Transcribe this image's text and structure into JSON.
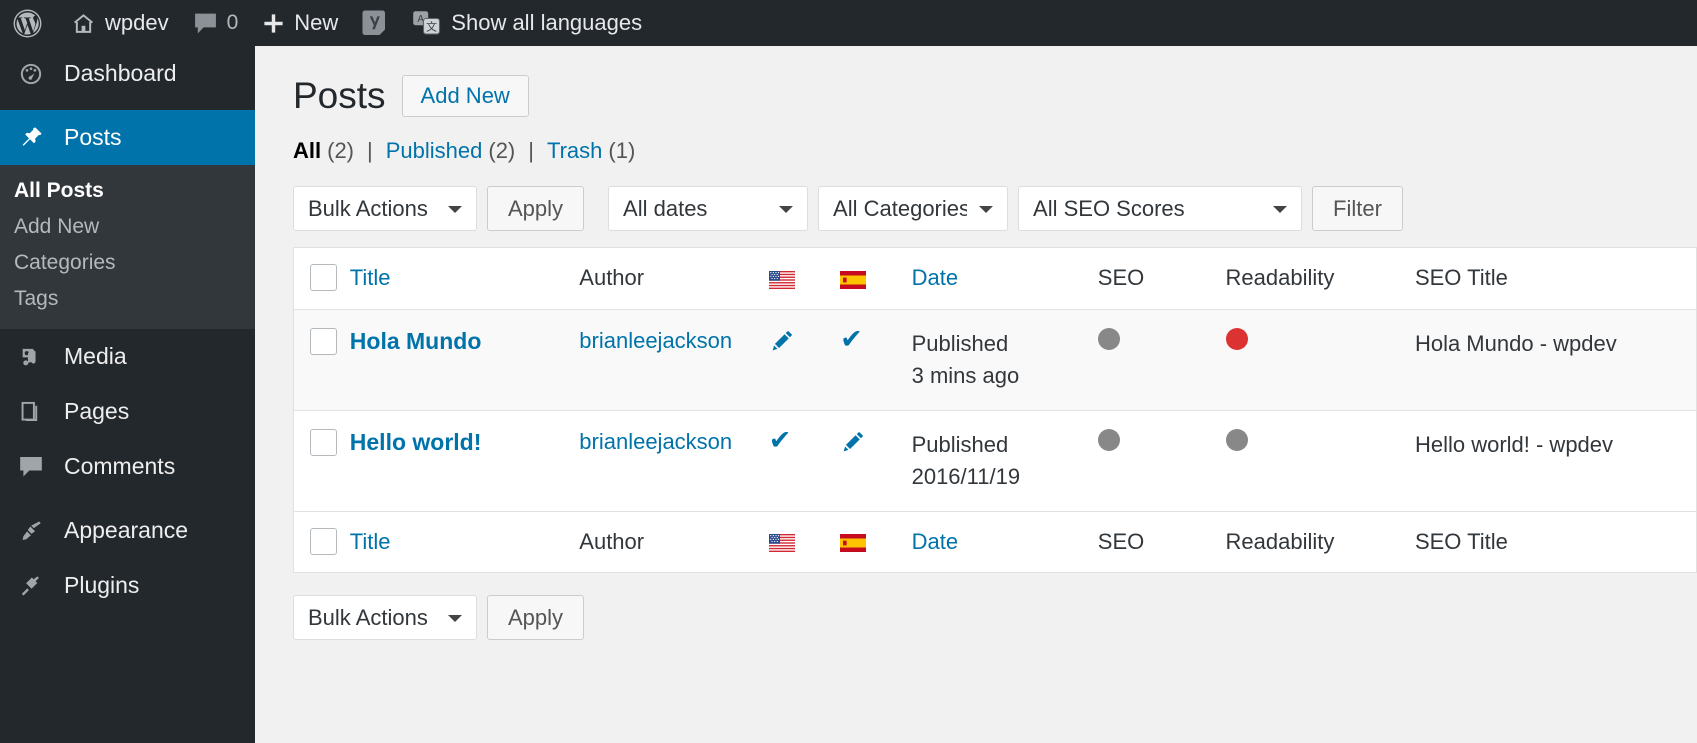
{
  "adminbar": {
    "logo_icon": "wordpress-logo-icon",
    "site_name": "wpdev",
    "site_icon": "home-icon",
    "comments_icon": "comment-bubble-icon",
    "comments_count": "0",
    "new_icon": "plus-icon",
    "new_label": "New",
    "yoast_icon": "yoast-seo-icon",
    "translate_icon": "translate-icon",
    "languages_label": "Show all languages"
  },
  "sidebar": {
    "items": [
      {
        "label": "Dashboard",
        "icon": "dashboard-icon",
        "current": false
      },
      {
        "label": "Posts",
        "icon": "pin-icon",
        "current": true
      },
      {
        "label": "Media",
        "icon": "media-icon",
        "current": false
      },
      {
        "label": "Pages",
        "icon": "pages-icon",
        "current": false
      },
      {
        "label": "Comments",
        "icon": "comment-bubble-icon",
        "current": false
      },
      {
        "label": "Appearance",
        "icon": "paintbrush-icon",
        "current": false
      },
      {
        "label": "Plugins",
        "icon": "plug-icon",
        "current": false
      }
    ],
    "submenu": [
      {
        "label": "All Posts",
        "current": true
      },
      {
        "label": "Add New",
        "current": false
      },
      {
        "label": "Categories",
        "current": false
      },
      {
        "label": "Tags",
        "current": false
      }
    ]
  },
  "page": {
    "title": "Posts",
    "add_new_label": "Add New",
    "views": [
      {
        "label": "All",
        "count": "(2)",
        "current": true
      },
      {
        "label": "Published",
        "count": "(2)",
        "current": false
      },
      {
        "label": "Trash",
        "count": "(1)",
        "current": false
      }
    ],
    "view_separator": "|"
  },
  "tablenav_top": {
    "bulk_actions_value": "Bulk Actions",
    "apply_label": "Apply",
    "dates_value": "All dates",
    "categories_value": "All Categories",
    "seo_scores_value": "All SEO Scores",
    "filter_label": "Filter"
  },
  "tablenav_bottom": {
    "bulk_actions_value": "Bulk Actions",
    "apply_label": "Apply"
  },
  "table": {
    "columns": {
      "title": "Title",
      "author": "Author",
      "lang_en": "us-flag-icon",
      "lang_es": "spain-flag-icon",
      "date": "Date",
      "seo": "SEO",
      "readability": "Readability",
      "seo_title": "SEO Title"
    },
    "rows": [
      {
        "title": "Hola Mundo",
        "author": "brianleejackson",
        "lang_en_icon": "pencil-icon",
        "lang_es_icon": "check-icon",
        "date_status": "Published",
        "date_value": "3 mins ago",
        "seo_score_color": "#888888",
        "readability_score_color": "#dc3232",
        "seo_title": "Hola Mundo - wpdev"
      },
      {
        "title": "Hello world!",
        "author": "brianleejackson",
        "lang_en_icon": "check-icon",
        "lang_es_icon": "pencil-icon",
        "date_status": "Published",
        "date_value": "2016/11/19",
        "seo_score_color": "#888888",
        "readability_score_color": "#888888",
        "seo_title": "Hello world! - wpdev"
      }
    ]
  },
  "colors": {
    "admin_bar_bg": "#23282d",
    "sidebar_bg": "#23282d",
    "current_menu_bg": "#0073aa",
    "link_blue": "#0073aa",
    "content_bg": "#f1f1f1",
    "score_gray": "#888888",
    "score_red": "#dc3232"
  }
}
